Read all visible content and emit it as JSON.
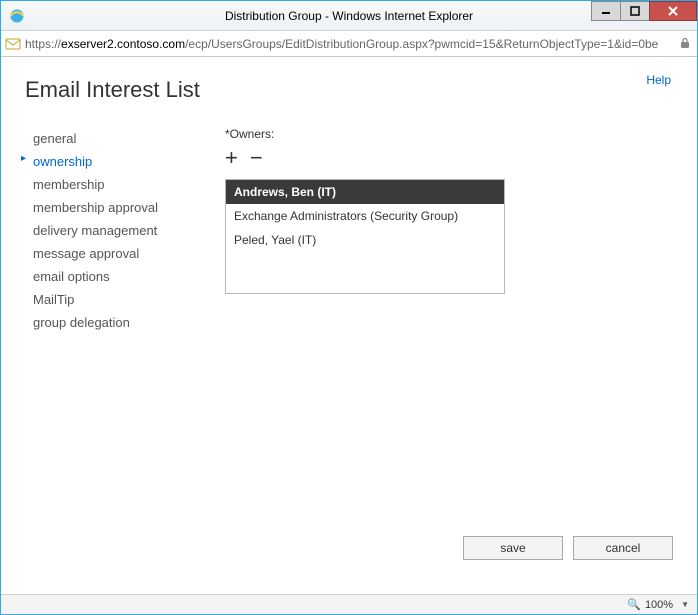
{
  "window": {
    "title": "Distribution Group - Windows Internet Explorer"
  },
  "address": {
    "scheme": "https://",
    "host": "exserver2.contoso.com",
    "path": "/ecp/UsersGroups/EditDistributionGroup.aspx?pwmcid=15&ReturnObjectType=1&id=0be"
  },
  "page": {
    "help": "Help",
    "heading": "Email Interest List"
  },
  "sidenav": {
    "items": [
      {
        "label": "general",
        "active": false
      },
      {
        "label": "ownership",
        "active": true
      },
      {
        "label": "membership",
        "active": false
      },
      {
        "label": "membership approval",
        "active": false
      },
      {
        "label": "delivery management",
        "active": false
      },
      {
        "label": "message approval",
        "active": false
      },
      {
        "label": "email options",
        "active": false
      },
      {
        "label": "MailTip",
        "active": false
      },
      {
        "label": "group delegation",
        "active": false
      }
    ]
  },
  "owners": {
    "label": "*Owners:",
    "addGlyph": "+",
    "removeGlyph": "−",
    "rows": [
      {
        "text": "Andrews, Ben (IT)",
        "selected": true
      },
      {
        "text": "Exchange Administrators (Security Group)",
        "selected": false
      },
      {
        "text": "Peled, Yael (IT)",
        "selected": false
      }
    ]
  },
  "buttons": {
    "save": "save",
    "cancel": "cancel"
  },
  "status": {
    "zoom": "100%"
  }
}
